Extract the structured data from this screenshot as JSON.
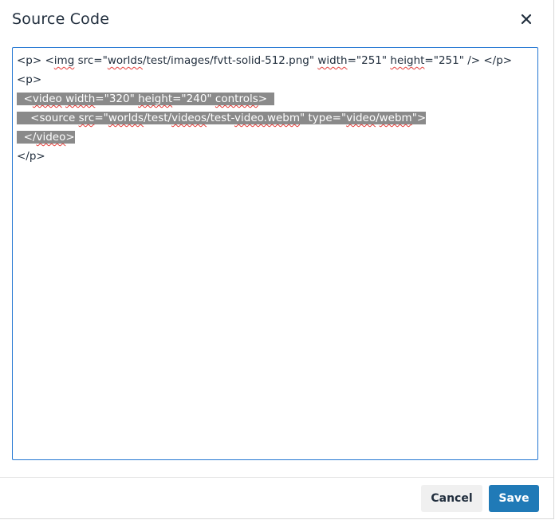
{
  "dialog": {
    "title": "Source Code",
    "close_icon": "close-icon"
  },
  "editor": {
    "lines": [
      {
        "segments": [
          {
            "t": "<p> <",
            "s": false
          },
          {
            "t": "img",
            "s": true
          },
          {
            "t": " src=\"",
            "s": false
          },
          {
            "t": "worlds",
            "s": true
          },
          {
            "t": "/test/images/fvtt-solid-512.png\" ",
            "s": false
          },
          {
            "t": "width",
            "s": true
          },
          {
            "t": "=\"251\" ",
            "s": false
          },
          {
            "t": "height",
            "s": true
          },
          {
            "t": "=\"251\" /> </p>",
            "s": false
          }
        ],
        "selected": false
      },
      {
        "segments": [
          {
            "t": "<p>",
            "s": false
          }
        ],
        "selected": false
      },
      {
        "segments": [
          {
            "t": "  <",
            "s": false
          },
          {
            "t": "video",
            "s": true
          },
          {
            "t": " ",
            "s": false
          },
          {
            "t": "width",
            "s": true
          },
          {
            "t": "=\"320\" ",
            "s": false
          },
          {
            "t": "height",
            "s": true
          },
          {
            "t": "=\"240\" ",
            "s": false
          },
          {
            "t": "controls",
            "s": true
          },
          {
            "t": ">  ",
            "s": false
          }
        ],
        "selected": true
      },
      {
        "segments": [
          {
            "t": "    <source ",
            "s": false
          },
          {
            "t": "src",
            "s": true
          },
          {
            "t": "=\"",
            "s": false
          },
          {
            "t": "worlds",
            "s": true
          },
          {
            "t": "/test/",
            "s": false
          },
          {
            "t": "videos",
            "s": true
          },
          {
            "t": "/test-",
            "s": false
          },
          {
            "t": "video.webm",
            "s": true
          },
          {
            "t": "\" type=\"",
            "s": false
          },
          {
            "t": "video",
            "s": true
          },
          {
            "t": "/",
            "s": false
          },
          {
            "t": "webm",
            "s": true
          },
          {
            "t": "\">",
            "s": false
          }
        ],
        "selected": true
      },
      {
        "segments": [
          {
            "t": "  </",
            "s": false
          },
          {
            "t": "video",
            "s": true
          },
          {
            "t": ">",
            "s": false
          }
        ],
        "selected": true
      },
      {
        "segments": [
          {
            "t": "</p>",
            "s": false
          }
        ],
        "selected": false
      }
    ]
  },
  "footer": {
    "cancel_label": "Cancel",
    "save_label": "Save"
  },
  "colors": {
    "accent": "#207ab7",
    "editor_border": "#2276d2",
    "selection": "#8a8a8a",
    "spellcheck": "#e53935"
  }
}
